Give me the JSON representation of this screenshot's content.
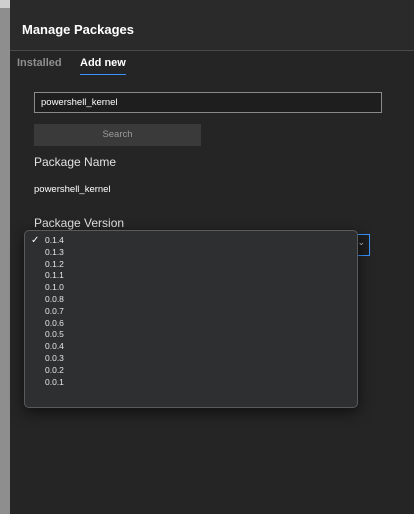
{
  "header": {
    "title": "Manage Packages"
  },
  "tabs": [
    {
      "label": "Installed",
      "active": false
    },
    {
      "label": "Add new",
      "active": true
    }
  ],
  "search": {
    "value": "powershell_kernel",
    "button_label": "Search"
  },
  "package": {
    "name_label": "Package Name",
    "name_value": "powershell_kernel",
    "version_label": "Package Version"
  },
  "versions": {
    "selected": "0.1.4",
    "options": [
      "0.1.4",
      "0.1.3",
      "0.1.2",
      "0.1.1",
      "0.1.0",
      "0.0.8",
      "0.0.7",
      "0.0.6",
      "0.0.5",
      "0.0.4",
      "0.0.3",
      "0.0.2",
      "0.0.1"
    ]
  },
  "icons": {
    "check": "checkmark-icon",
    "chevron": "chevron-down-icon"
  },
  "colors": {
    "accent": "#3794ff",
    "background": "#252526"
  }
}
